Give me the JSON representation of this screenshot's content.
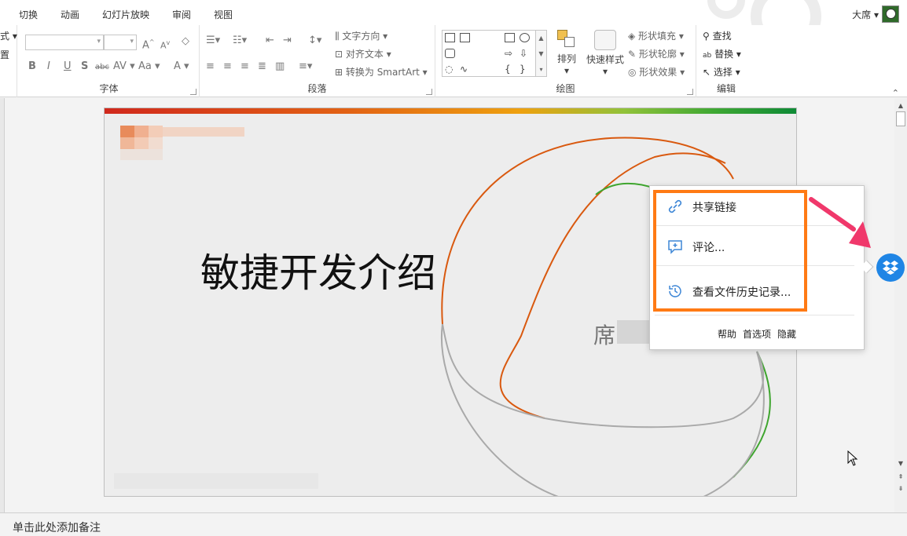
{
  "tabs": [
    "切换",
    "动画",
    "幻灯片放映",
    "审阅",
    "视图"
  ],
  "user": {
    "name": "大席"
  },
  "ribbon": {
    "font": {
      "label": "字体",
      "bold": "B",
      "italic": "I",
      "underline": "U",
      "shadow": "S",
      "strike": "abc",
      "spacing": "AV",
      "case": "Aa",
      "grow": "A",
      "shrink": "A",
      "color": "A"
    },
    "paragraph": {
      "label": "段落",
      "text_direction": "文字方向",
      "align_text": "对齐文本",
      "smartart": "转换为 SmartArt"
    },
    "drawing": {
      "label": "绘图",
      "arrange": "排列",
      "quick_styles": "快速样式",
      "fill": "形状填充",
      "outline": "形状轮廓",
      "effects": "形状效果"
    },
    "editing": {
      "label": "编辑",
      "find": "查找",
      "replace": "替换",
      "select": "选择"
    },
    "partial_left": [
      "式",
      "置"
    ]
  },
  "slide": {
    "title": "敏捷开发介绍",
    "author": "席"
  },
  "notes": {
    "placeholder": "单击此处添加备注"
  },
  "dropbox_menu": {
    "items": [
      {
        "label": "共享链接",
        "icon": "link-icon"
      },
      {
        "label": "评论...",
        "icon": "comment-icon"
      },
      {
        "label": "查看文件历史记录...",
        "icon": "history-icon"
      }
    ],
    "footer": {
      "help": "帮助",
      "prefs": "首选项",
      "hide": "隐藏"
    }
  },
  "colors": {
    "highlight": "#ff7a14",
    "arrow": "#f0386b",
    "dropbox": "#1f85e5",
    "curve_orange": "#d9590f",
    "curve_green": "#3ea52e",
    "curve_gray": "#a9a9a9"
  }
}
